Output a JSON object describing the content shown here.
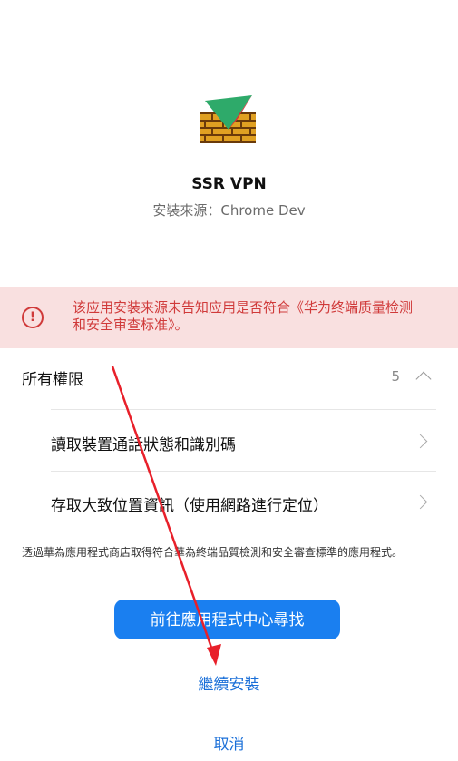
{
  "app": {
    "name": "SSR VPN",
    "source": "安裝來源：Chrome Dev"
  },
  "warning": {
    "text": "该应用安装来源未告知应用是否符合《华为终端质量检测和安全审查标准》。",
    "icon": "!"
  },
  "permissions": {
    "title": "所有權限",
    "count": "5",
    "items": [
      {
        "label": "讀取裝置通話狀態和識別碼"
      },
      {
        "label": "存取大致位置資訊（使用網路進行定位）"
      }
    ]
  },
  "notice": "透過華為應用程式商店取得符合華為終端品質檢測和安全審查標準的應用程式。",
  "actions": {
    "primary": "前往應用程式中心尋找",
    "continue": "繼續安裝",
    "cancel": "取消"
  },
  "colors": {
    "accent": "#1a7ff0",
    "warning": "#d03a3a",
    "warning_bg": "#f9e0e0",
    "annotation": "#e8202a"
  },
  "icons": [
    "firewall-app-icon",
    "warning-icon",
    "chevron-up-icon",
    "chevron-right-icon",
    "red-arrow-annotation"
  ]
}
